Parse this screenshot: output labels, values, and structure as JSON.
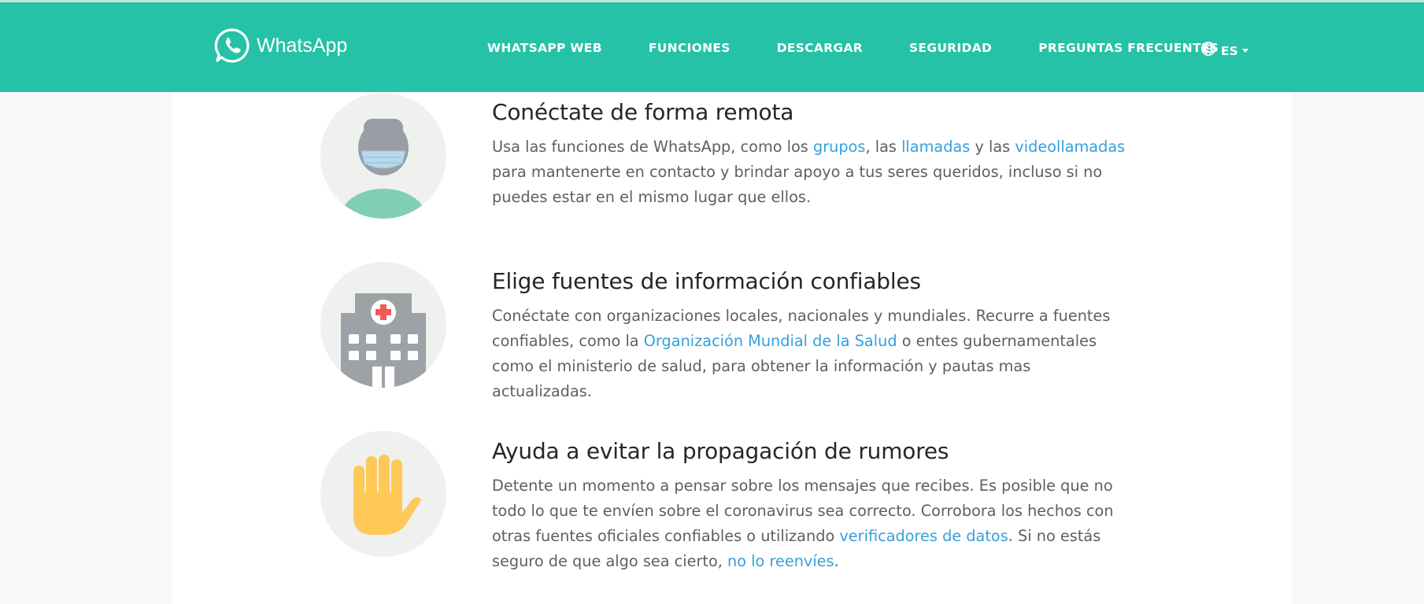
{
  "header": {
    "brand": "WhatsApp",
    "nav": [
      "WHATSAPP WEB",
      "FUNCIONES",
      "DESCARGAR",
      "SEGURIDAD",
      "PREGUNTAS FRECUENTES"
    ],
    "language": "ES",
    "colors": {
      "header_bg": "#25c2a8",
      "link": "#34a0dc"
    }
  },
  "features": [
    {
      "icon": "masked-person-icon",
      "title": "Conéctate de forma remota",
      "p1": "Usa las funciones de WhatsApp, como los ",
      "link1": "grupos",
      "p2": ", las ",
      "link2": "llamadas",
      "p3": " y las ",
      "link3": "videollamadas",
      "p4": " para mantenerte en contacto y brindar apoyo a tus seres queridos, incluso si no puedes estar en el mismo lugar que ellos."
    },
    {
      "icon": "hospital-icon",
      "title": "Elige fuentes de información confiables",
      "p1": "Conéctate con organizaciones locales, nacionales y mundiales. Recurre a fuentes confiables, como la ",
      "link1": "Organización Mundial de la Salud",
      "p2": " o entes gubernamentales como el ministerio de salud, para obtener la información y pautas mas actualizadas."
    },
    {
      "icon": "stop-hand-icon",
      "title": "Ayuda a evitar la propagación de rumores",
      "p1": "Detente un momento a pensar sobre los mensajes que recibes. Es posible que no todo lo que te envíen sobre el coronavirus sea correcto. Corrobora los hechos con otras fuentes oficiales confiables o utilizando ",
      "link1": "verificadores de datos",
      "p2": ". Si no estás seguro de que algo sea cierto, ",
      "link2": "no lo reenvíes",
      "p3": "."
    }
  ]
}
